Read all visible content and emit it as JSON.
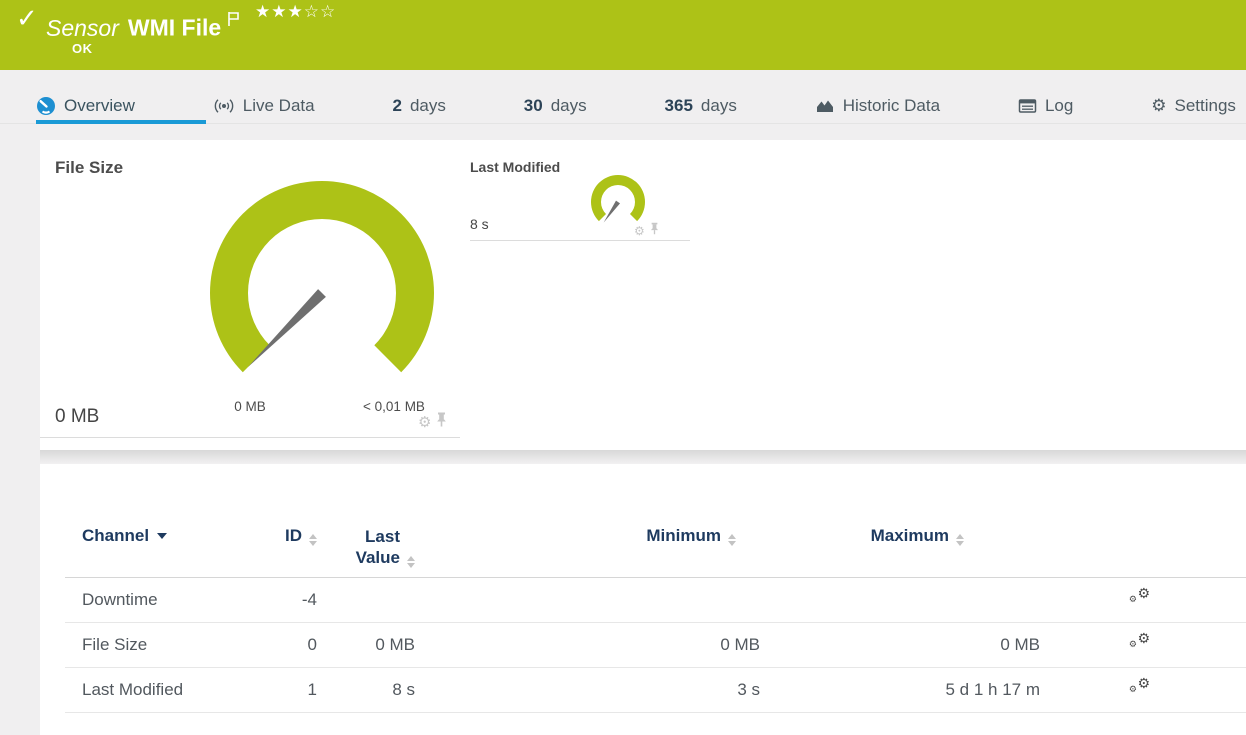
{
  "header": {
    "sensor_kind": "Sensor",
    "sensor_name": "WMI File",
    "status": "OK",
    "priority_filled": 3,
    "priority_total": 5,
    "stars_filled": "★★★",
    "stars_empty": "☆☆"
  },
  "tabs": [
    {
      "label": "Overview",
      "icon": "gauge-icon",
      "active": true
    },
    {
      "label": "Live Data",
      "icon": "broadcast-icon"
    },
    {
      "prefix": "2",
      "label": "days"
    },
    {
      "prefix": "30",
      "label": "days"
    },
    {
      "prefix": "365",
      "label": "days"
    },
    {
      "label": "Historic Data",
      "icon": "area-chart-icon"
    },
    {
      "label": "Log",
      "icon": "log-icon"
    },
    {
      "label": "Settings",
      "icon": "gear-icon"
    }
  ],
  "gauges": {
    "file_size": {
      "title": "File Size",
      "value": "0 MB",
      "scale_start": "0 MB",
      "scale_end": "< 0,01 MB"
    },
    "last_modified": {
      "title": "Last Modified",
      "value": "8 s"
    }
  },
  "channel_table": {
    "headers": {
      "channel": "Channel",
      "id": "ID",
      "last_value": "Last Value",
      "minimum": "Minimum",
      "maximum": "Maximum"
    },
    "rows": [
      {
        "channel": "Downtime",
        "id": "-4",
        "last_value": "",
        "minimum": "",
        "maximum": ""
      },
      {
        "channel": "File Size",
        "id": "0",
        "last_value": "0 MB",
        "minimum": "0 MB",
        "maximum": "0 MB"
      },
      {
        "channel": "Last Modified",
        "id": "1",
        "last_value": "8 s",
        "minimum": "3 s",
        "maximum": "5 d 1 h 17 m"
      }
    ]
  },
  "icons": {
    "gear_glyph": "⚙",
    "check_glyph": "✓"
  },
  "colors": {
    "brand_green": "#adc217",
    "active_tab_blue": "#1a9ad6",
    "overview_icon_blue": "#1d8fd1",
    "header_navy": "#1e3a5f",
    "needle_gray": "#6f6f6f"
  }
}
